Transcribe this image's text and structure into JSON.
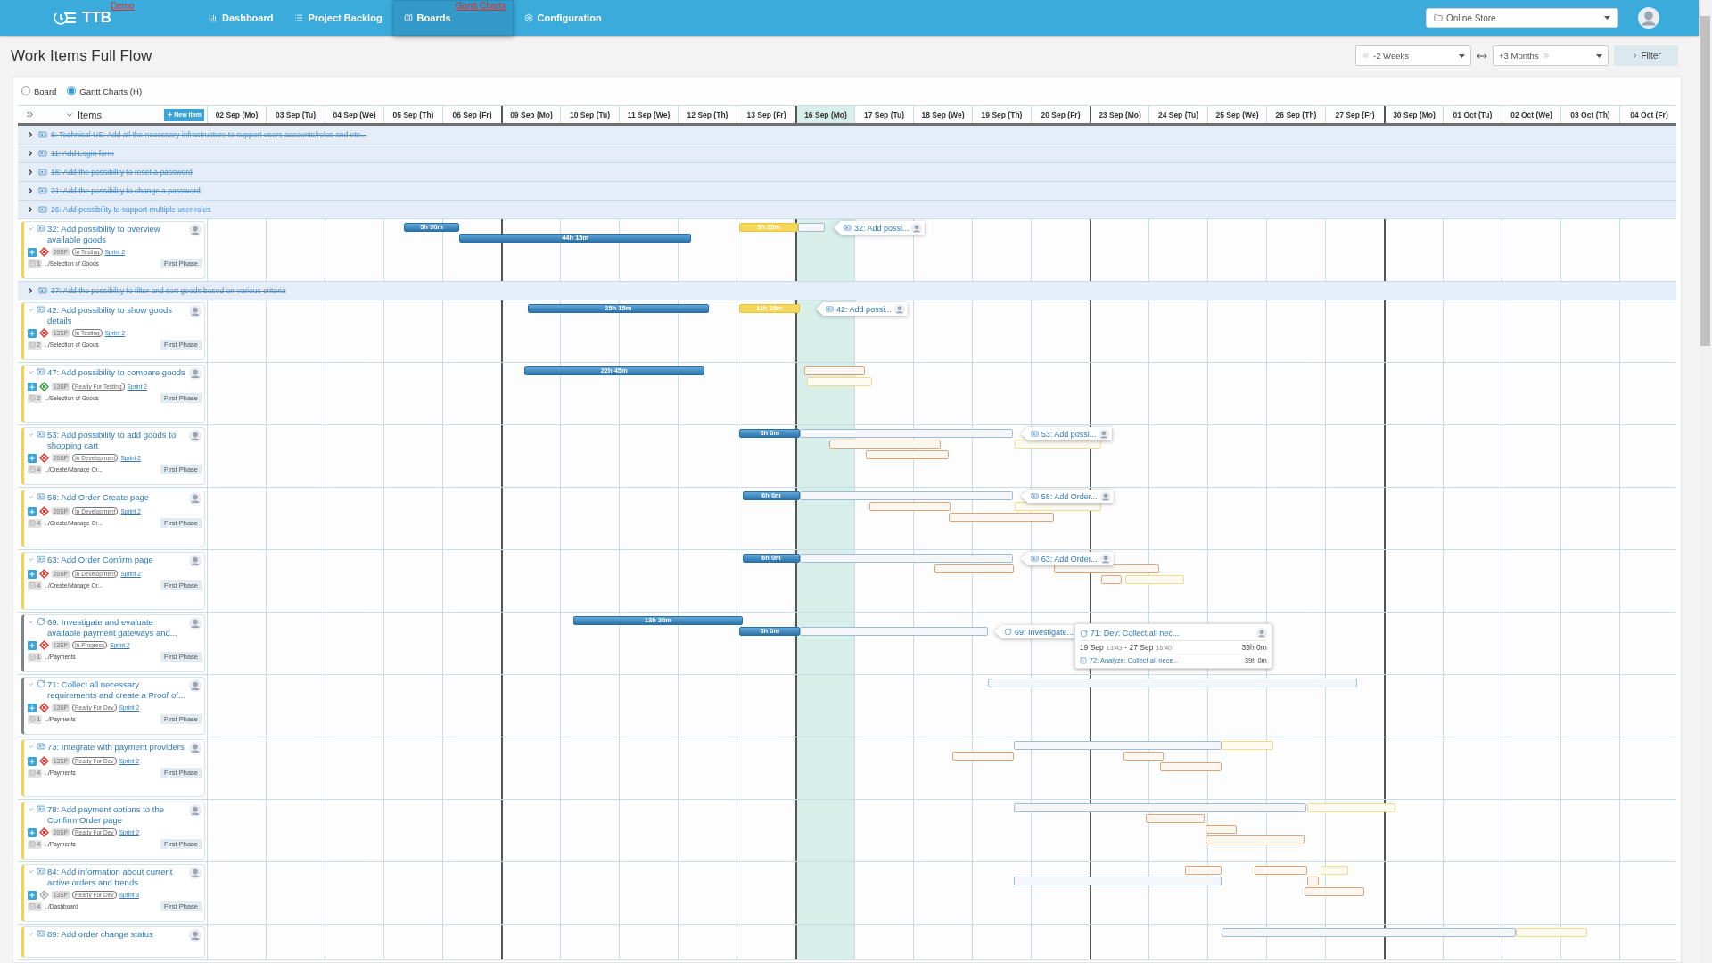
{
  "nav": {
    "logo": "TTB",
    "demo_label": "Demo",
    "items": [
      {
        "label": "Dashboard",
        "selected": false
      },
      {
        "label": "Project Backlog",
        "selected": false
      },
      {
        "label": "Boards",
        "selected": true,
        "sublabel": "Gantt Charts"
      },
      {
        "label": "Configuration",
        "selected": false
      }
    ],
    "project_select": "Online Store"
  },
  "page_title": "Work Items Full Flow",
  "range": {
    "from": "-2 Weeks",
    "to": "+3 Months",
    "filter": "Filter"
  },
  "view_options": [
    {
      "label": "Board",
      "selected": false
    },
    {
      "label": "Gantt Charts (H)",
      "selected": true
    }
  ],
  "gantt": {
    "items_label": "Items",
    "new_item": "New Item",
    "days": [
      {
        "label": "02 Sep (Mo)",
        "today": false
      },
      {
        "label": "03 Sep (Tu)",
        "today": false
      },
      {
        "label": "04 Sep (We)",
        "today": false
      },
      {
        "label": "05 Sep (Th)",
        "today": false
      },
      {
        "label": "06 Sep (Fr)",
        "today": false
      },
      {
        "label": "09 Sep (Mo)",
        "today": false
      },
      {
        "label": "10 Sep (Tu)",
        "today": false
      },
      {
        "label": "11 Sep (We)",
        "today": false
      },
      {
        "label": "12 Sep (Th)",
        "today": false
      },
      {
        "label": "13 Sep (Fr)",
        "today": false
      },
      {
        "label": "16 Sep (Mo)",
        "today": true
      },
      {
        "label": "17 Sep (Tu)",
        "today": false
      },
      {
        "label": "18 Sep (We)",
        "today": false
      },
      {
        "label": "19 Sep (Th)",
        "today": false
      },
      {
        "label": "20 Sep (Fr)",
        "today": false
      },
      {
        "label": "23 Sep (Mo)",
        "today": false
      },
      {
        "label": "24 Sep (Tu)",
        "today": false
      },
      {
        "label": "25 Sep (We)",
        "today": false
      },
      {
        "label": "26 Sep (Th)",
        "today": false
      },
      {
        "label": "27 Sep (Fr)",
        "today": false
      },
      {
        "label": "30 Sep (Mo)",
        "today": false
      },
      {
        "label": "01 Oct (Tu)",
        "today": false
      },
      {
        "label": "02 Oct (We)",
        "today": false
      },
      {
        "label": "03 Oct (Th)",
        "today": false
      },
      {
        "label": "04 Oct (Fr)",
        "today": false
      }
    ],
    "rows": [
      {
        "title": "6: Technical US: Add all the necessary infrastructure to support users accounts/roles and etc...",
        "kind": "story",
        "expanded": false,
        "done": true
      },
      {
        "title": "11: Add Login form",
        "kind": "story",
        "expanded": false,
        "done": true
      },
      {
        "title": "16: Add the possibility to reset a password",
        "kind": "story",
        "expanded": false,
        "done": true
      },
      {
        "title": "21: Add the possibility to change a password",
        "kind": "story",
        "expanded": false,
        "done": true
      },
      {
        "title": "26: Add possibility to support multiple user roles",
        "kind": "story",
        "expanded": false,
        "done": true
      },
      {
        "title": "32: Add possibility to overview available goods",
        "kind": "story",
        "expanded": true,
        "done": false,
        "color": "#e0403a",
        "estimate": "20SP",
        "status": "In Testing",
        "sprint": "Sprint 2",
        "tasks": "1",
        "path": "../Selection of Goods",
        "phase": "First Phase",
        "bars": [
          {
            "kind": "done",
            "label": "5h 30m"
          },
          {
            "kind": "done",
            "label": "44h 15m"
          },
          {
            "kind": "current",
            "label": "5h 25m"
          },
          {
            "kind": "planned"
          }
        ],
        "callout": "32: Add possi..."
      },
      {
        "title": "37: Add the possibility to filter and sort goods based on various criteria",
        "kind": "story",
        "expanded": false,
        "done": true
      },
      {
        "title": "42: Add possibility to show goods details",
        "kind": "story",
        "expanded": true,
        "done": false,
        "color": "#e0403a",
        "estimate": "13SP",
        "status": "In Testing",
        "sprint": "Sprint 2",
        "tasks": "2",
        "path": "../Selection of Goods",
        "phase": "First Phase",
        "bars": [
          {
            "kind": "done",
            "label": "25h 15m"
          },
          {
            "kind": "current",
            "label": "11h 25m"
          }
        ],
        "callout": "42: Add possi..."
      },
      {
        "title": "47: Add possibility to compare goods",
        "kind": "story",
        "expanded": true,
        "done": false,
        "color": "#3fa34d",
        "estimate": "13SP",
        "status": "Ready For Testing",
        "sprint": "Sprint 2",
        "tasks": "2",
        "path": "../Selection of Goods",
        "phase": "First Phase",
        "bars": [
          {
            "kind": "done",
            "label": "22h 45m"
          },
          {
            "kind": "subtask"
          },
          {
            "kind": "pending"
          }
        ]
      },
      {
        "title": "53: Add possibility to add goods to shopping cart",
        "kind": "story",
        "expanded": true,
        "done": false,
        "color": "#e0403a",
        "estimate": "20SP",
        "status": "In Development",
        "sprint": "Sprint 2",
        "tasks": "4",
        "path": "../Create/Manage Or...",
        "phase": "First Phase",
        "bars": [
          {
            "kind": "done",
            "label": "6h 0m"
          },
          {
            "kind": "planned"
          },
          {
            "kind": "subtask"
          },
          {
            "kind": "subtask"
          },
          {
            "kind": "pending"
          }
        ],
        "callout": "53: Add possi..."
      },
      {
        "title": "58: Add Order Create page",
        "kind": "story",
        "expanded": true,
        "done": false,
        "color": "#e0403a",
        "estimate": "20SP",
        "status": "In Development",
        "sprint": "Sprint 2",
        "tasks": "4",
        "path": "../Create/Manage Or...",
        "phase": "First Phase",
        "bars": [
          {
            "kind": "done",
            "label": "6h 0m"
          },
          {
            "kind": "planned"
          },
          {
            "kind": "subtask"
          },
          {
            "kind": "subtask"
          },
          {
            "kind": "pending"
          }
        ],
        "callout": "58: Add Order..."
      },
      {
        "title": "63: Add Order Confirm page",
        "kind": "story",
        "expanded": true,
        "done": false,
        "color": "#e0403a",
        "estimate": "20SP",
        "status": "In Development",
        "sprint": "Sprint 2",
        "tasks": "4",
        "path": "../Create/Manage Or...",
        "phase": "First Phase",
        "bars": [
          {
            "kind": "done",
            "label": "6h 0m"
          },
          {
            "kind": "planned"
          },
          {
            "kind": "subtask"
          },
          {
            "kind": "subtask"
          },
          {
            "kind": "subtask"
          },
          {
            "kind": "pending"
          }
        ],
        "callout": "63: Add Order..."
      },
      {
        "title": "69: Investigate and evaluate available payment gateways and...",
        "kind": "task",
        "expanded": true,
        "done": false,
        "color": "#e0403a",
        "estimate": "13SP",
        "status": "In Progress",
        "sprint": "Sprint 2",
        "tasks": "1",
        "path": "../Payments",
        "phase": "First Phase",
        "bars": [
          {
            "kind": "done",
            "label": "13h 20m"
          },
          {
            "kind": "done",
            "label": "6h 0m"
          },
          {
            "kind": "planned"
          }
        ],
        "callout": "69: Investigate...",
        "popup": {
          "title": "71: Dev: Collect all nec...",
          "start_date": "19 Sep",
          "start_time": "13:43",
          "end_date": "- 27 Sep",
          "end_time": "16:40",
          "duration": "39h 0m",
          "subtask": "72: Analyze: Collect all nece...",
          "subtask_duration": "39h 0m"
        }
      },
      {
        "title": "71: Collect all necessary requirements and create a Proof of...",
        "kind": "task",
        "expanded": true,
        "done": false,
        "color": "#e0403a",
        "estimate": "13SP",
        "status": "Ready For Dev",
        "sprint": "Sprint 2",
        "tasks": "1",
        "path": "../Payments",
        "phase": "First Phase",
        "bars": [
          {
            "kind": "planned"
          }
        ]
      },
      {
        "title": "73: Integrate with payment providers",
        "kind": "story",
        "expanded": true,
        "done": false,
        "color": "#e0403a",
        "estimate": "13SP",
        "status": "Ready For Dev",
        "sprint": "Sprint 2",
        "tasks": "4",
        "path": "../Payments",
        "phase": "First Phase",
        "bars": [
          {
            "kind": "planned"
          },
          {
            "kind": "pending"
          },
          {
            "kind": "subtask"
          },
          {
            "kind": "subtask"
          },
          {
            "kind": "subtask"
          }
        ]
      },
      {
        "title": "78: Add payment options to the Confirm Order page",
        "kind": "story",
        "expanded": true,
        "done": false,
        "color": "#e0403a",
        "estimate": "20SP",
        "status": "Ready For Dev",
        "sprint": "Sprint 2",
        "tasks": "4",
        "path": "../Payments",
        "phase": "First Phase",
        "bars": [
          {
            "kind": "planned"
          },
          {
            "kind": "pending"
          },
          {
            "kind": "subtask"
          },
          {
            "kind": "subtask"
          },
          {
            "kind": "subtask"
          }
        ]
      },
      {
        "title": "84: Add information about current active orders and trends",
        "kind": "story",
        "expanded": true,
        "done": false,
        "color": "#b8b8b8",
        "estimate": "13SP",
        "status": "Ready For Dev",
        "sprint": "Sprint 3",
        "tasks": "4",
        "path": "../Dashboard",
        "phase": "First Phase",
        "bars": [
          {
            "kind": "subtask"
          },
          {
            "kind": "subtask"
          },
          {
            "kind": "pending"
          },
          {
            "kind": "planned"
          },
          {
            "kind": "subtask"
          },
          {
            "kind": "subtask"
          }
        ]
      },
      {
        "title": "89: Add order change status",
        "kind": "story",
        "expanded": true,
        "done": false,
        "bars": [
          {
            "kind": "planned"
          },
          {
            "kind": "pending"
          }
        ]
      }
    ]
  }
}
